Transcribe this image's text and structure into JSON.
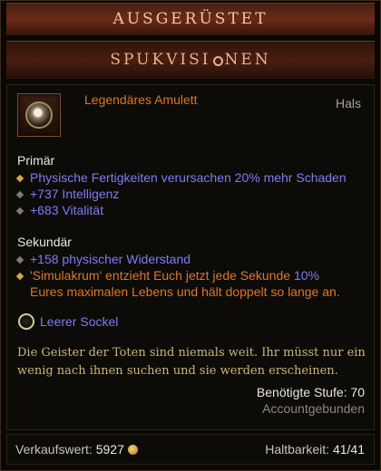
{
  "tabs": {
    "equipped": "AUSGERÜSTET",
    "set_name_pre": "SPUKVISI",
    "set_name_post": "NEN"
  },
  "item": {
    "icon": "amulet-icon",
    "name": "Legendäres Amulett",
    "slot": "Hals"
  },
  "primary": {
    "title": "Primär",
    "props": [
      "Physische Fertigkeiten verursachen 20% mehr Schaden",
      "+737 Intelligenz",
      "+683 Vitalität"
    ]
  },
  "secondary": {
    "title": "Sekundär",
    "props": [
      "+158 physischer Widerstand"
    ],
    "legendary_line1_pre": "'Simulakrum' entzieht Euch jetzt jede Sekunde ",
    "legendary_line1_num": "10%",
    "legendary_line2": "Eures maximalen Lebens und hält doppelt so lange an."
  },
  "socket": {
    "label": "Leerer Sockel"
  },
  "flavor": {
    "line1": "Die Geister der Toten sind niemals weit. Ihr müsst nur ein",
    "line2": "wenig nach ihnen suchen und sie werden erscheinen."
  },
  "requirements": {
    "level": "Benötigte Stufe: 70",
    "binding": "Accountgebunden"
  },
  "footer": {
    "sell_label": "Verkaufswert:",
    "sell_value": "5927",
    "durability_label": "Haltbarkeit:",
    "durability_value": "41/41"
  },
  "colors": {
    "legendary": "#d9782e",
    "magic": "#7b7cf2",
    "flavor": "#c9b67a",
    "bound": "#8c8780"
  }
}
